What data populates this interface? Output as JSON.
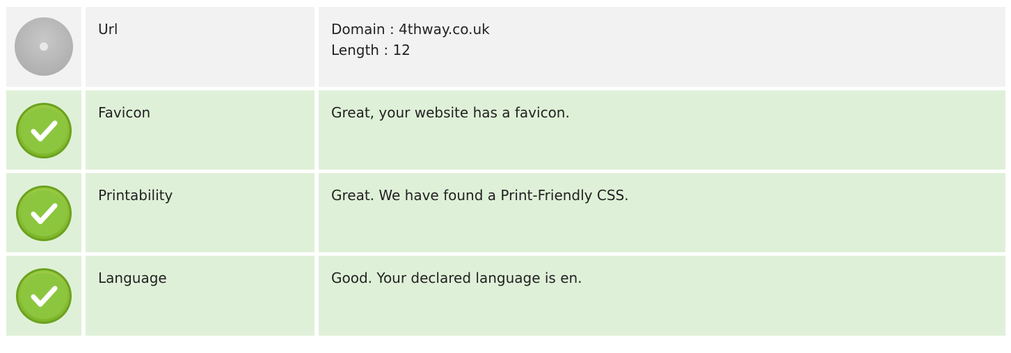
{
  "rows": [
    {
      "status": "neutral",
      "icon": "info-dot-icon",
      "name": "Url",
      "lines": [
        "Domain : 4thway.co.uk",
        "Length : 12"
      ]
    },
    {
      "status": "pass",
      "icon": "check-icon",
      "name": "Favicon",
      "lines": [
        "Great, your website has a favicon."
      ]
    },
    {
      "status": "pass",
      "icon": "check-icon",
      "name": "Printability",
      "lines": [
        "Great. We have found a Print-Friendly CSS."
      ]
    },
    {
      "status": "pass",
      "icon": "check-icon",
      "name": "Language",
      "lines": [
        "Good. Your declared language is en."
      ]
    }
  ],
  "colors": {
    "pass_background": "#dff0d8",
    "neutral_background": "#f2f2f2",
    "check_green": "#8cc63f",
    "neutral_grey": "#b4b4b4"
  }
}
